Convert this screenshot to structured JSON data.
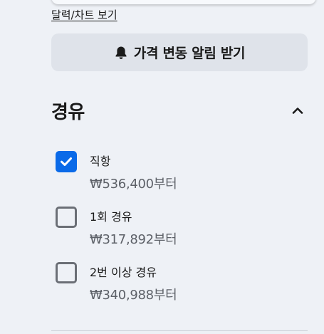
{
  "calendar_link": {
    "label": "달력/차트 보기"
  },
  "alert_button": {
    "label": "가격 변동 알림 받기",
    "icon": "bell-icon"
  },
  "stops_section": {
    "title": "경유",
    "toggle_icon": "chevron-up-icon",
    "options": [
      {
        "label": "직항",
        "price": "₩536,400부터",
        "checked": true
      },
      {
        "label": "1회 경유",
        "price": "₩317,892부터",
        "checked": false
      },
      {
        "label": "2번 이상 경유",
        "price": "₩340,988부터",
        "checked": false
      }
    ]
  },
  "colors": {
    "background": "#eef1f6",
    "button_bg": "#dfe3ea",
    "checkbox_checked": "#0a6ae8",
    "checkbox_border": "#6b6f76",
    "price_text": "#5d6168"
  }
}
